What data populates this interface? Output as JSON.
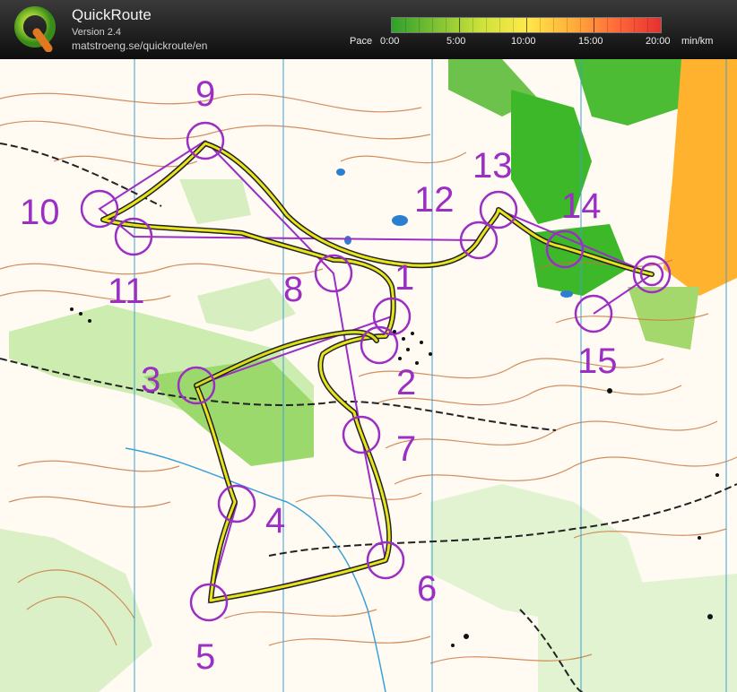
{
  "app": {
    "title": "QuickRoute",
    "version": "Version 2.4",
    "url": "matstroeng.se/quickroute/en"
  },
  "pace_legend": {
    "label": "Pace",
    "ticks": [
      "0:00",
      "5:00",
      "10:00",
      "15:00",
      "20:00"
    ],
    "unit": "min/km",
    "gradient_colors": [
      "#2fa02a",
      "#7fc232",
      "#cde23a",
      "#ffe94a",
      "#ffb03a",
      "#ff6a3a",
      "#e53030"
    ]
  },
  "map": {
    "controls": [
      {
        "label": "1"
      },
      {
        "label": "2"
      },
      {
        "label": "3"
      },
      {
        "label": "4"
      },
      {
        "label": "5"
      },
      {
        "label": "6"
      },
      {
        "label": "7"
      },
      {
        "label": "8"
      },
      {
        "label": "9"
      },
      {
        "label": "10"
      },
      {
        "label": "11"
      },
      {
        "label": "12"
      },
      {
        "label": "13"
      },
      {
        "label": "14"
      },
      {
        "label": "15"
      }
    ],
    "course_color": "#9b2fc4",
    "route_color": "#e8e41c"
  }
}
